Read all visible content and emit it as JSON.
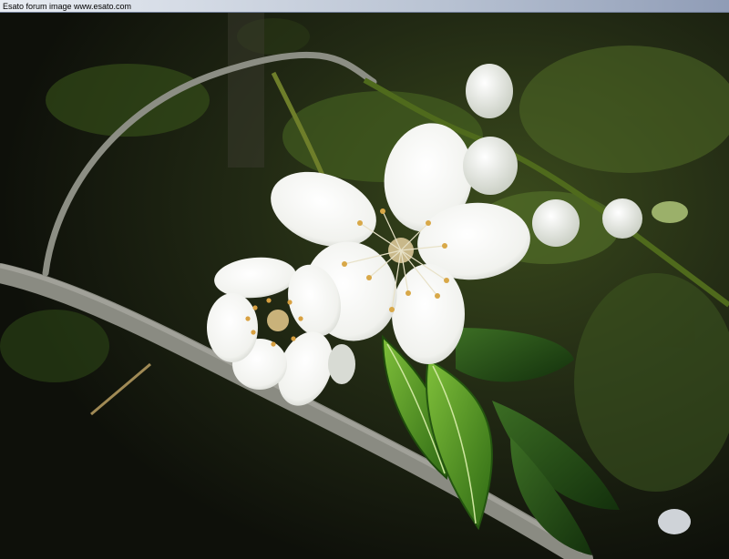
{
  "header": {
    "caption": "Esato forum image www.esato.com"
  },
  "photo": {
    "subject_icons": [
      "blossom-icon",
      "branch-icon",
      "leaf-icon",
      "bud-icon"
    ],
    "colors": {
      "background_dark": "#15170f",
      "moss_green": "#4f6a22",
      "branch_gray": "#8a8a80",
      "petal_white": "#f4f5f2",
      "leaf_green": "#3f8a1f",
      "stamen_yellow": "#d8b050"
    }
  }
}
